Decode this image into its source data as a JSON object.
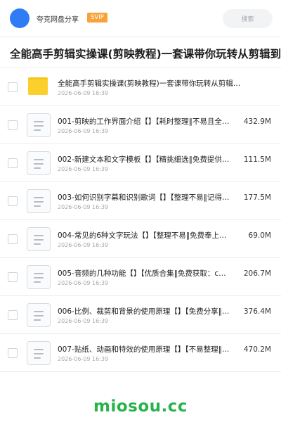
{
  "header": {
    "site_name": "夸克网盘分享",
    "badge": "SVIP",
    "search_placeholder": "搜索"
  },
  "page_title": "全能高手剪辑实操课(剪映教程)一套课带你玩转从剪辑到创",
  "files": [
    {
      "type": "folder",
      "name": "全能高手剪辑实操课(剪映教程)一套课带你玩转从剪辑…",
      "date": "2026-06-09 16:39",
      "size": ""
    },
    {
      "type": "doc",
      "name": "001-剪映的工作界面介绍【】【耗时整理‖不易且全…",
      "date": "2026-06-09 16:39",
      "size": "432.9M"
    },
    {
      "type": "doc",
      "name": "002-新建文本和文字模板【】【精挑细选‖免费提供…",
      "date": "2026-06-09 16:39",
      "size": "111.5M"
    },
    {
      "type": "doc",
      "name": "003-如何识别字幕和识别歌词【】【整理不易‖记得…",
      "date": "2026-06-09 16:39",
      "size": "177.5M"
    },
    {
      "type": "doc",
      "name": "004-常见的6种文字玩法【】【整理不易‖免费奉上…",
      "date": "2026-06-09 16:39",
      "size": "69.0M"
    },
    {
      "type": "doc",
      "name": "005-音频的几种功能【】【优质合集‖免费获取：c…",
      "date": "2026-06-09 16:39",
      "size": "206.7M"
    },
    {
      "type": "doc",
      "name": "006-比例、裁剪和背景的使用原理【】【免费分享‖…",
      "date": "2026-06-09 16:39",
      "size": "376.4M"
    },
    {
      "type": "doc",
      "name": "007-贴纸、动画和特效的使用原理【】【不易整理‖…",
      "date": "2026-06-09 16:39",
      "size": "470.2M"
    }
  ],
  "watermark": "miosou.cc",
  "colors": {
    "avatar": "#2f7cf6",
    "badge": "#f7a23a",
    "folder": "#fbd02c",
    "watermark": "#27b24a"
  }
}
